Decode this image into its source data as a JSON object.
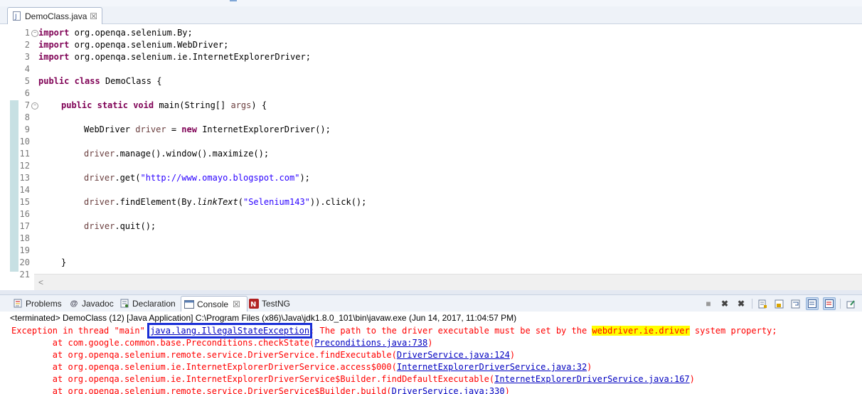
{
  "editor": {
    "tab_label": "DemoClass.java",
    "close_glyph": "☒",
    "line_numbers": [
      "1",
      "2",
      "3",
      "4",
      "5",
      "6",
      "7",
      "8",
      "9",
      "10",
      "11",
      "12",
      "13",
      "14",
      "15",
      "16",
      "17",
      "18",
      "19",
      "20",
      "21"
    ],
    "code": {
      "l1_kw": "import",
      "l1_rest": " org.openqa.selenium.By;",
      "l2_kw": "import",
      "l2_rest": " org.openqa.selenium.WebDriver;",
      "l3_kw": "import",
      "l3_rest": " org.openqa.selenium.ie.InternetExplorerDriver;",
      "l5_kw1": "public",
      "l5_kw2": "class",
      "l5_rest": " DemoClass {",
      "l7_kw1": "public",
      "l7_kw2": "static",
      "l7_kw3": "void",
      "l7_rest": " main(String[] ",
      "l7_var": "args",
      "l7_end": ") {",
      "l9_type": "WebDriver ",
      "l9_var": "driver",
      "l9_eq": " = ",
      "l9_kw": "new",
      "l9_rest": " InternetExplorerDriver();",
      "l11_var": "driver",
      "l11_rest": ".manage().window().maximize();",
      "l13_var": "driver",
      "l13_a": ".get(",
      "l13_str": "\"http://www.omayo.blogspot.com\"",
      "l13_b": ");",
      "l15_var": "driver",
      "l15_a": ".findElement(By.",
      "l15_it": "linkText",
      "l15_b": "(",
      "l15_str": "\"Selenium143\"",
      "l15_c": ")).click();",
      "l17_var": "driver",
      "l17_rest": ".quit();",
      "l20": "}"
    },
    "scroll_arrow": "<"
  },
  "views": {
    "tabs": [
      {
        "label": "Problems"
      },
      {
        "label": "Javadoc"
      },
      {
        "label": "Declaration"
      },
      {
        "label": "Console"
      },
      {
        "label": "TestNG"
      }
    ],
    "console_close": "☒"
  },
  "console": {
    "terminated": "<terminated> DemoClass (12) [Java Application] C:\\Program Files (x86)\\Java\\jdk1.8.0_101\\bin\\javaw.exe (Jun 14, 2017, 11:04:57 PM)",
    "exception_prefix": "Exception in thread \"main\" ",
    "exception_link": "java.lang.IllegalStateException",
    "exception_msg": ": The path to the driver executable must be set by the ",
    "exception_prop": "webdriver.ie.driver",
    "exception_tail": " system property;",
    "stack": [
      {
        "text": "\tat com.google.common.base.Preconditions.checkState(",
        "link": "Preconditions.java:738",
        "end": ")"
      },
      {
        "text": "\tat org.openqa.selenium.remote.service.DriverService.findExecutable(",
        "link": "DriverService.java:124",
        "end": ")"
      },
      {
        "text": "\tat org.openqa.selenium.ie.InternetExplorerDriverService.access$000(",
        "link": "InternetExplorerDriverService.java:32",
        "end": ")"
      },
      {
        "text": "\tat org.openqa.selenium.ie.InternetExplorerDriverService$Builder.findDefaultExecutable(",
        "link": "InternetExplorerDriverService.java:167",
        "end": ")"
      },
      {
        "text": "\tat org.openqa.selenium.remote.service.DriverService$Builder.build(",
        "link": "DriverService.java:330",
        "end": ")"
      }
    ]
  },
  "colors": {
    "keyword": "#7f0055",
    "string": "#2a00ff",
    "error": "#ff0000",
    "link": "#0000c0",
    "highlight_box": "#1a2fd6",
    "highlight_yellow": "#ffff00"
  }
}
